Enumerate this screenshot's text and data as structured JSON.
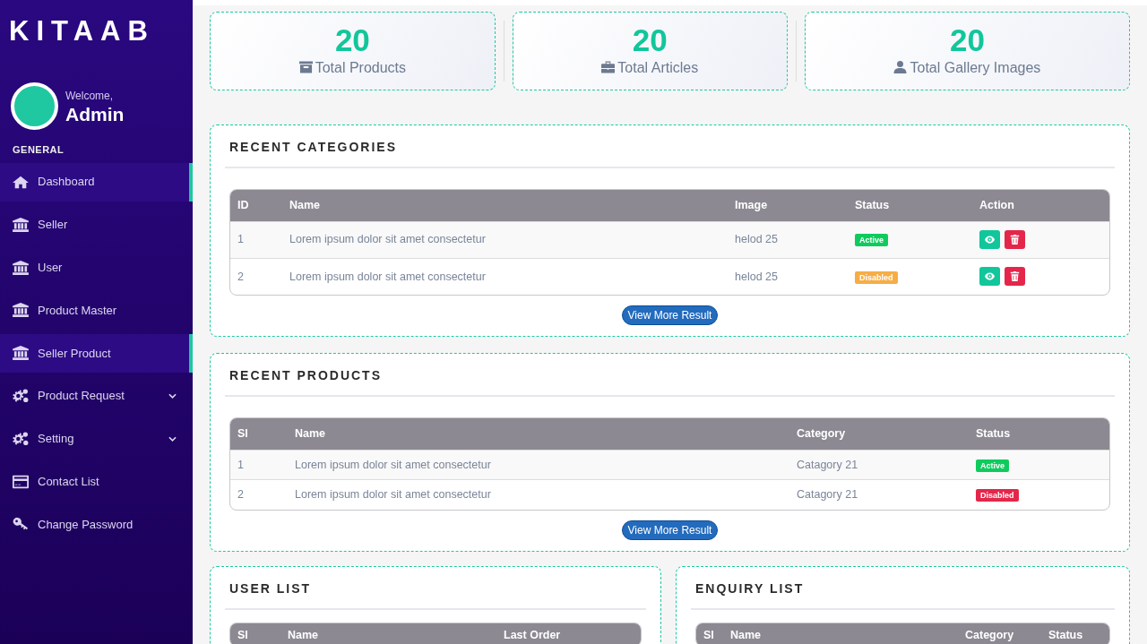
{
  "brand": "KITAAB",
  "user": {
    "greeting": "Welcome,",
    "name": "Admin"
  },
  "sidebar": {
    "section": "GENERAL",
    "items": [
      {
        "label": "Dashboard",
        "kind": "home",
        "selected": true,
        "submenu": false
      },
      {
        "label": "Seller",
        "kind": "bank",
        "selected": false,
        "submenu": false
      },
      {
        "label": "User",
        "kind": "bank",
        "selected": false,
        "submenu": false
      },
      {
        "label": "Product Master",
        "kind": "bank",
        "selected": false,
        "submenu": false
      },
      {
        "label": "Seller Product",
        "kind": "bank",
        "selected": true,
        "submenu": false
      },
      {
        "label": "Product Request",
        "kind": "gears",
        "selected": false,
        "submenu": true
      },
      {
        "label": "Setting",
        "kind": "gears",
        "selected": false,
        "submenu": true
      },
      {
        "label": "Contact List",
        "kind": "card",
        "selected": false,
        "submenu": false
      },
      {
        "label": "Change Password",
        "kind": "key",
        "selected": false,
        "submenu": false
      }
    ]
  },
  "stats": [
    {
      "value": "20",
      "label": "Total Products",
      "kind": "archive"
    },
    {
      "value": "20",
      "label": "Total Articles",
      "kind": "briefcase"
    },
    {
      "value": "20",
      "label": "Total Gallery Images",
      "kind": "user"
    }
  ],
  "recent_categories": {
    "title": "RECENT CATEGORIES",
    "columns": [
      "ID",
      "Name",
      "Image",
      "Status",
      "Action"
    ],
    "rows": [
      {
        "id": "1",
        "name": "Lorem ipsum dolor sit amet consectetur",
        "image": "helod 25",
        "status": "Active",
        "color": "#0fcb5e"
      },
      {
        "id": "2",
        "name": "Lorem ipsum dolor sit amet consectetur",
        "image": "helod 25",
        "status": "Disabled",
        "color": "#f6ad45"
      }
    ],
    "button": "View More Result"
  },
  "recent_products": {
    "title": "RECENT PRODUCTS",
    "columns": [
      "SI",
      "Name",
      "Category",
      "Status"
    ],
    "rows": [
      {
        "id": "1",
        "name": "Lorem ipsum dolor sit amet consectetur",
        "category": "Catagory 21",
        "status": "Active",
        "color": "#0fcb5e"
      },
      {
        "id": "2",
        "name": "Lorem ipsum dolor sit amet consectetur",
        "category": "Catagory 21",
        "status": "Disabled",
        "color": "#e3264a"
      }
    ],
    "button": "View More Result"
  },
  "user_list": {
    "title": "USER LIST",
    "columns": [
      "SI",
      "Name",
      "Last Order"
    ]
  },
  "enquiry_list": {
    "title": "ENQUIRY LIST",
    "columns": [
      "SI",
      "Name",
      "Category",
      "Status"
    ]
  }
}
